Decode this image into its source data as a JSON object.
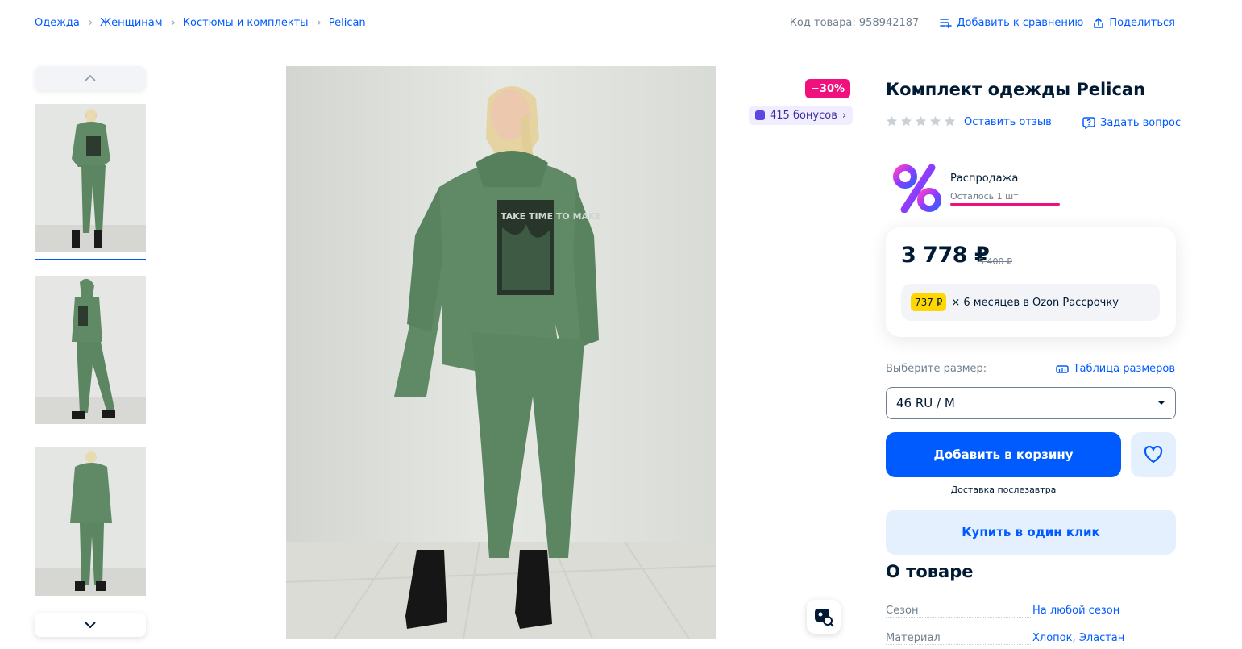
{
  "breadcrumbs": [
    "Одежда",
    "Женщинам",
    "Костюмы и комплекты",
    "Pelican"
  ],
  "header": {
    "sku": "Код товара: 958942187",
    "compare": "Добавить к сравнению",
    "share": "Поделиться"
  },
  "gallery": {
    "discount_badge": "−30%",
    "bonus": "415 бонусов",
    "print_text": "TAKE TIME TO MAKE"
  },
  "product": {
    "title": "Комплект одежды Pelican",
    "review_link": "Оставить отзыв",
    "ask_link": "Задать вопрос"
  },
  "sale": {
    "title": "Распродажа",
    "left": "Осталось 1 шт"
  },
  "price": {
    "current": "3 778 ₽",
    "old": "5 400 ₽",
    "installment_amount": "737 ₽",
    "installment_text": "× 6 месяцев в Ozon Рассрочку"
  },
  "size": {
    "label": "Выберите размер:",
    "table_link": "Таблица размеров",
    "selected": "46 RU / M"
  },
  "actions": {
    "add_to_cart": "Добавить в корзину",
    "delivery_prefix": "Доставка",
    "delivery_day": "послезавтра",
    "one_click": "Купить в один клик"
  },
  "about": {
    "title": "О товаре",
    "specs": [
      {
        "key": "Сезон",
        "value": "На любой сезон"
      },
      {
        "key": "Материал",
        "value": "Хлопок, Эластан"
      }
    ]
  },
  "colors": {
    "accent": "#005bff",
    "discount": "#f1117e",
    "outfit": "#5f8a65"
  }
}
